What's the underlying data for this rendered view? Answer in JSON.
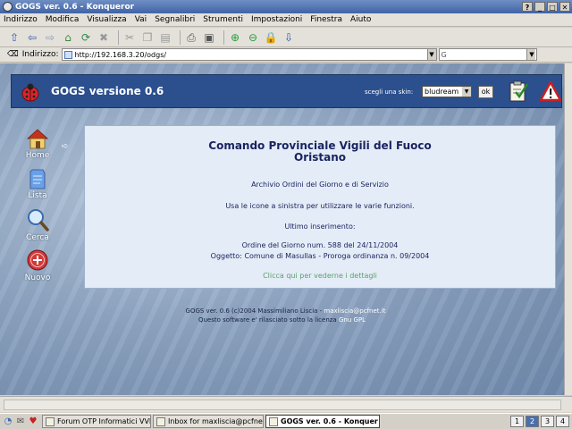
{
  "window": {
    "title": "GOGS ver. 0.6 - Konqueror",
    "buttons": [
      "?",
      "_",
      "□",
      "✕"
    ]
  },
  "menu": [
    "Indirizzo",
    "Modifica",
    "Visualizza",
    "Vai",
    "Segnalibri",
    "Strumenti",
    "Impostazioni",
    "Finestra",
    "Aiuto"
  ],
  "toolbar": {
    "icons": [
      "up-arrow-icon",
      "back-icon",
      "forward-icon",
      "home-icon",
      "reload-icon",
      "stop-icon",
      "cut-icon",
      "copy-icon",
      "paste-icon",
      "print-icon",
      "print-preview-icon",
      "zoom-in-icon",
      "zoom-out-icon",
      "security-lock-icon",
      "download-icon"
    ]
  },
  "location": {
    "label": "Indirizzo:",
    "url": "http://192.168.3.20/odgs/",
    "search_value": ""
  },
  "header": {
    "title": "GOGS versione 0.6",
    "skin_label": "scegli una skin:",
    "skin_value": "bludream",
    "ok_label": "ok"
  },
  "nav": {
    "home": "Home",
    "lista": "Lista",
    "cerca": "Cerca",
    "nuovo": "Nuovo"
  },
  "content": {
    "title_line1": "Comando Provinciale Vigili del Fuoco",
    "title_line2": "Oristano",
    "archive": "Archivio Ordini del Giorno e di Servizio",
    "hint": "Usa le icone a sinistra per utilizzare le varie funzioni.",
    "last_label": "Ultimo inserimento:",
    "last_order": "Ordine del Giorno num. 588 del 24/11/2004",
    "last_subject": "Oggetto: Comune di Masullas - Proroga ordinanza n. 09/2004",
    "details_link": "Clicca qui per vederne i dettagli"
  },
  "footer": {
    "line1_text": "GOGS ver. 0.6 (c)2004 Massimiliano Liscia -",
    "email": "maxliscia@pcfnet.it",
    "line2_text": "Questo software e' rilasciato sotto la licenza",
    "license": "Gnu GPL"
  },
  "taskbar": {
    "tasks": [
      {
        "label": "Forum OTP Informatici VVF:",
        "active": false
      },
      {
        "label": "Inbox for maxliscia@pcfnet.",
        "active": false
      },
      {
        "label": "GOGS ver. 0.6 - Konquer",
        "active": true
      }
    ],
    "desktops": [
      "1",
      "2",
      "3",
      "4"
    ],
    "current_desktop": "2"
  }
}
